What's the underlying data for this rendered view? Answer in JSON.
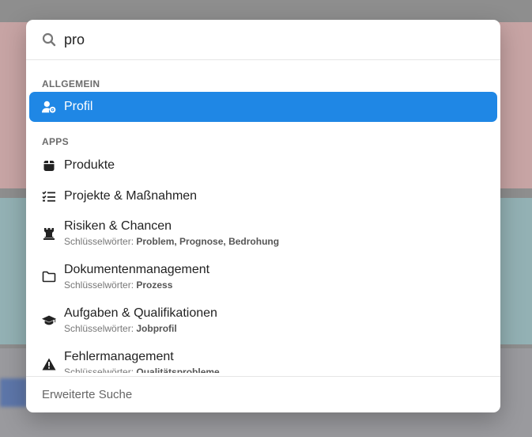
{
  "search": {
    "value": "pro",
    "placeholder": ""
  },
  "sections": [
    {
      "label": "ALLGEMEIN",
      "items": [
        {
          "label": "Profil",
          "icon": "user-gear-icon",
          "selected": true
        }
      ]
    },
    {
      "label": "APPS",
      "items": [
        {
          "label": "Produkte",
          "icon": "box-icon"
        },
        {
          "label": "Projekte & Maßnahmen",
          "icon": "list-check-icon"
        },
        {
          "label": "Risiken & Chancen",
          "icon": "chess-rook-icon",
          "keywords_prefix": "Schlüsselwörter:",
          "keywords": "Problem, Prognose, Bedrohung"
        },
        {
          "label": "Dokumentenmanagement",
          "icon": "folder-icon",
          "keywords_prefix": "Schlüsselwörter:",
          "keywords": "Prozess"
        },
        {
          "label": "Aufgaben & Qualifikationen",
          "icon": "graduation-cap-icon",
          "keywords_prefix": "Schlüsselwörter:",
          "keywords": "Jobprofil"
        },
        {
          "label": "Fehlermanagement",
          "icon": "warning-icon",
          "keywords_prefix": "Schlüsselwörter:",
          "keywords": "Qualitätsprobleme"
        }
      ]
    }
  ],
  "footer": {
    "label": "Erweiterte Suche"
  },
  "colors": {
    "accent": "#1f87e5"
  }
}
